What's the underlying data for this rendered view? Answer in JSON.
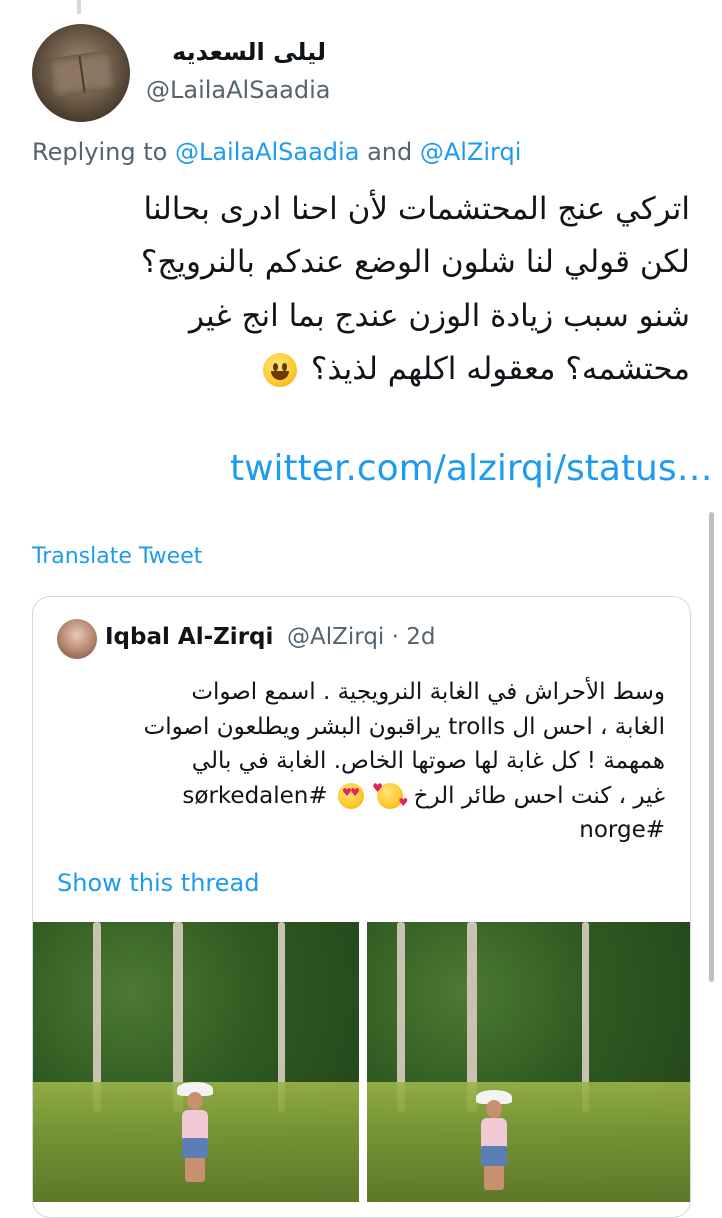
{
  "author": {
    "display_name": "ليلى السعديه",
    "handle": "@LailaAlSaadia"
  },
  "reply_context": {
    "prefix": "Replying to",
    "mention_1": "@LailaAlSaadia",
    "conjunction": "and",
    "mention_2": "@AlZirqi"
  },
  "tweet": {
    "line_1": "اتركي عنج المحتشمات لأن احنا ادرى بحالنا",
    "line_2": "لكن قولي لنا شلون الوضع عندكم بالنرويج؟",
    "line_3": "شنو سبب زيادة الوزن عندج بما انج غير",
    "line_4": "محتشمه؟ معقوله اكلهم لذيذ؟",
    "link": "twitter.com/alzirqi/status…"
  },
  "translate_label": "Translate Tweet",
  "quoted_tweet": {
    "display_name": "Iqbal Al-Zirqi",
    "handle": "@AlZirqi",
    "separator": "·",
    "time": "2d",
    "line_1": "وسط الأحراش في الغابة النرويجية . اسمع اصوات",
    "line_2": "الغابة ، احس ال trolls يراقبون البشر ويطلعون اصوات",
    "line_3": "همهمة ! كل غابة لها صوتها الخاص. الغابة في بالي",
    "line_4": "غير ، كنت احس طائر الرخ",
    "hashtag_1": "#sørkedalen",
    "hashtag_2": "#norge",
    "show_thread_label": "Show this thread"
  },
  "icons": {
    "tweet_emoji": "grinning-face-emoji",
    "quote_emoji_1": "smiling-face-with-hearts-emoji",
    "quote_emoji_2": "heart-eyes-emoji"
  }
}
